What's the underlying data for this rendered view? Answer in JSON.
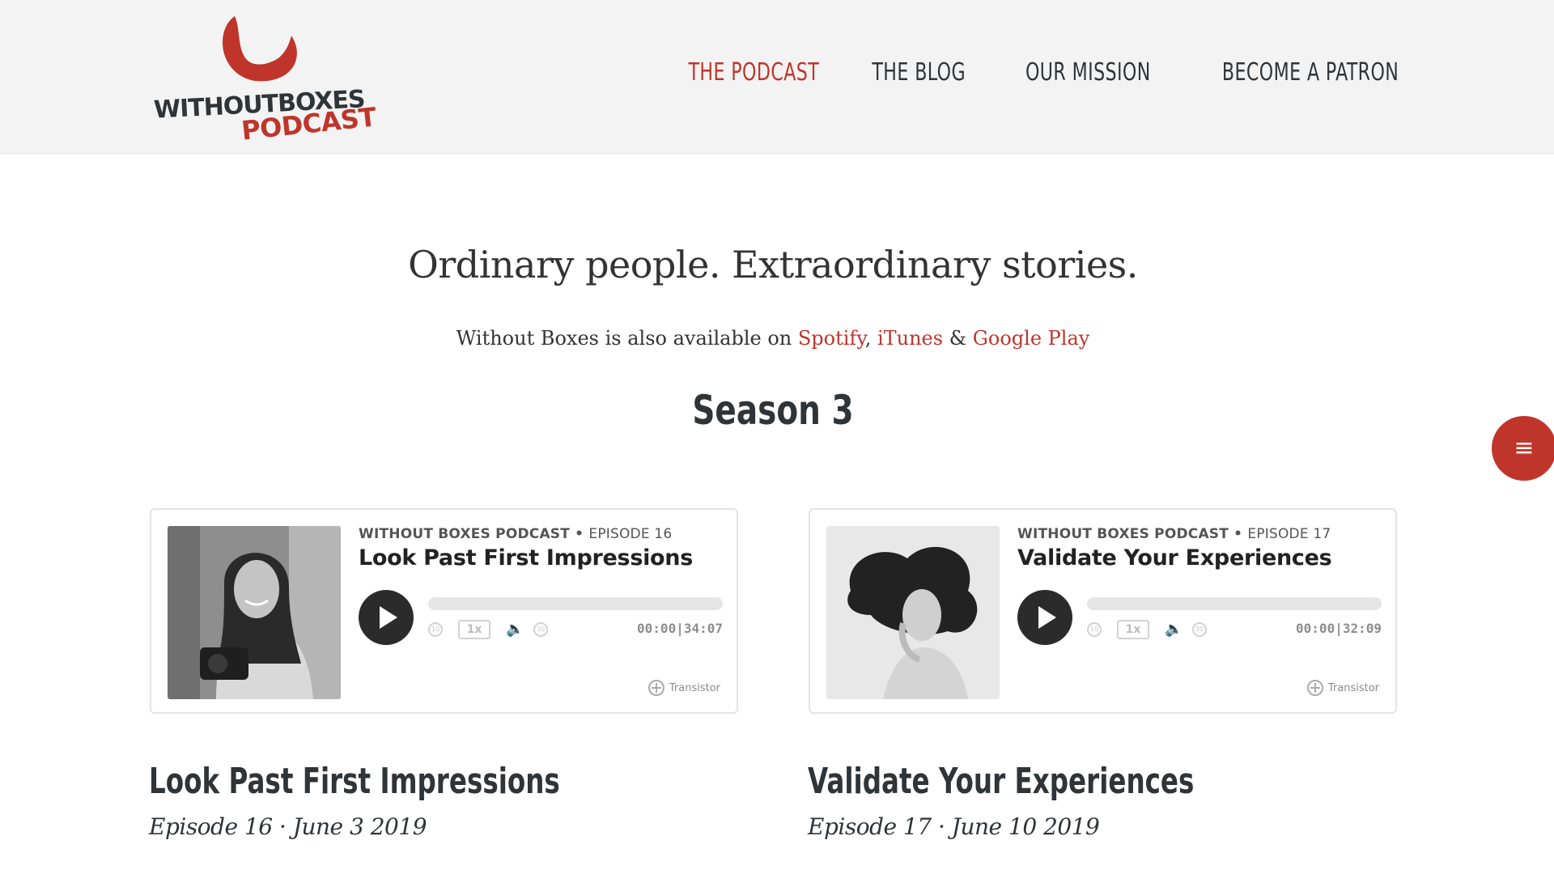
{
  "header": {
    "logo": {
      "line1": "WITHOUTBOXES",
      "line2": "PODCAST",
      "colors": {
        "dark": "#2f3438",
        "red": "#c0352b"
      }
    },
    "nav": [
      {
        "label": "THE PODCAST",
        "active": true
      },
      {
        "label": "THE BLOG",
        "active": false
      },
      {
        "label": "OUR MISSION",
        "active": false
      },
      {
        "label": "BECOME A PATRON",
        "active": false
      }
    ]
  },
  "hero": {
    "tagline": "Ordinary people. Extraordinary stories.",
    "availability": {
      "prefix": "Without Boxes is also available on ",
      "spotify": "Spotify",
      "sep1": ", ",
      "itunes": "iTunes",
      "sep2": " & ",
      "google": "Google Play"
    },
    "season": "Season 3"
  },
  "menu_button": {
    "icon": "menu-icon"
  },
  "episodes": [
    {
      "player": {
        "show": "WITHOUT BOXES PODCAST",
        "dot": " • ",
        "episode": "EPISODE 16",
        "title": "Look Past First Impressions",
        "speed": "1x",
        "time": "00:00|34:07",
        "progress": 0,
        "brand": "Transistor"
      },
      "title": "Look Past First Impressions",
      "date": "Episode 16 · June 3 2019",
      "excerpt": "... ... ... ..."
    },
    {
      "player": {
        "show": "WITHOUT BOXES PODCAST",
        "dot": " • ",
        "episode": "EPISODE 17",
        "title": "Validate Your Experiences",
        "speed": "1x",
        "time": "00:00|32:09",
        "progress": 0,
        "brand": "Transistor"
      },
      "title": "Validate Your Experiences",
      "date": "Episode 17 · June 10 2019",
      "excerpt": "... ... ... ..."
    }
  ],
  "colors": {
    "accent": "#c0352b",
    "heading": "#2f3438",
    "header_bg": "#f3f3f3"
  }
}
